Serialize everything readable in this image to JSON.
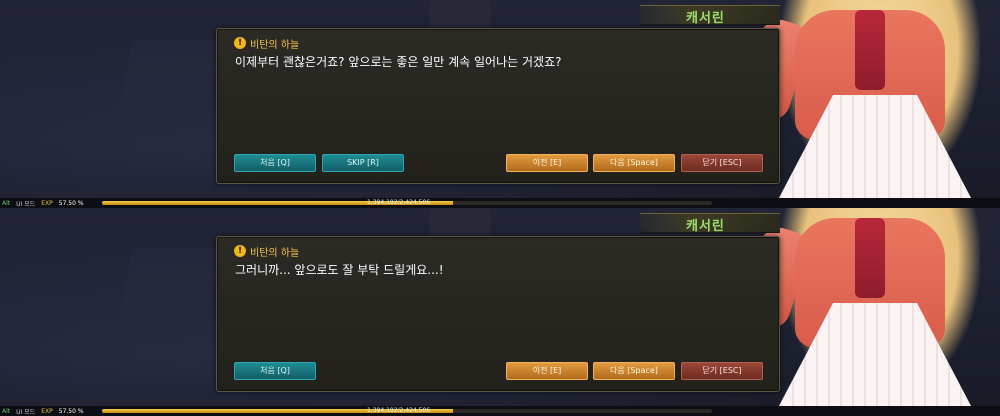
{
  "speaker_name": "캐서린",
  "dialog_title": "비탄의 하늘",
  "panels": [
    {
      "message": "이제부터 괜찮은거죠? 앞으로는 좋은 일만 계속 일어나는 거겠죠?",
      "buttons": {
        "first": "처음 [Q]",
        "skip": "SKIP [R]",
        "prev": "이전 [E]",
        "next": "다음 [Space]",
        "close": "닫기 [ESC]"
      }
    },
    {
      "message": "그러니까... 앞으로도 잘 부탁 드릴게요...!",
      "buttons": {
        "first": "처음 [Q]",
        "prev": "이전 [E]",
        "next": "다음 [Space]",
        "close": "닫기 [ESC]"
      }
    }
  ],
  "status": {
    "alt_label": "Alt",
    "ui_mode": "UI 모드",
    "exp_label": "EXP",
    "exp_percent": "57.50 %",
    "exp_fraction": 0.575,
    "exp_value": "1,394,192/2,424,506"
  },
  "colors": {
    "speaker_name": "#9ee06a",
    "dialog_title": "#f0c64a",
    "teal_button": "#1f8c94",
    "orange_button": "#e19a3e",
    "red_button": "#9a4638",
    "exp_bar": "#f7c94a"
  },
  "icons": {
    "dialog_title_icon": "exclamation-circle"
  }
}
